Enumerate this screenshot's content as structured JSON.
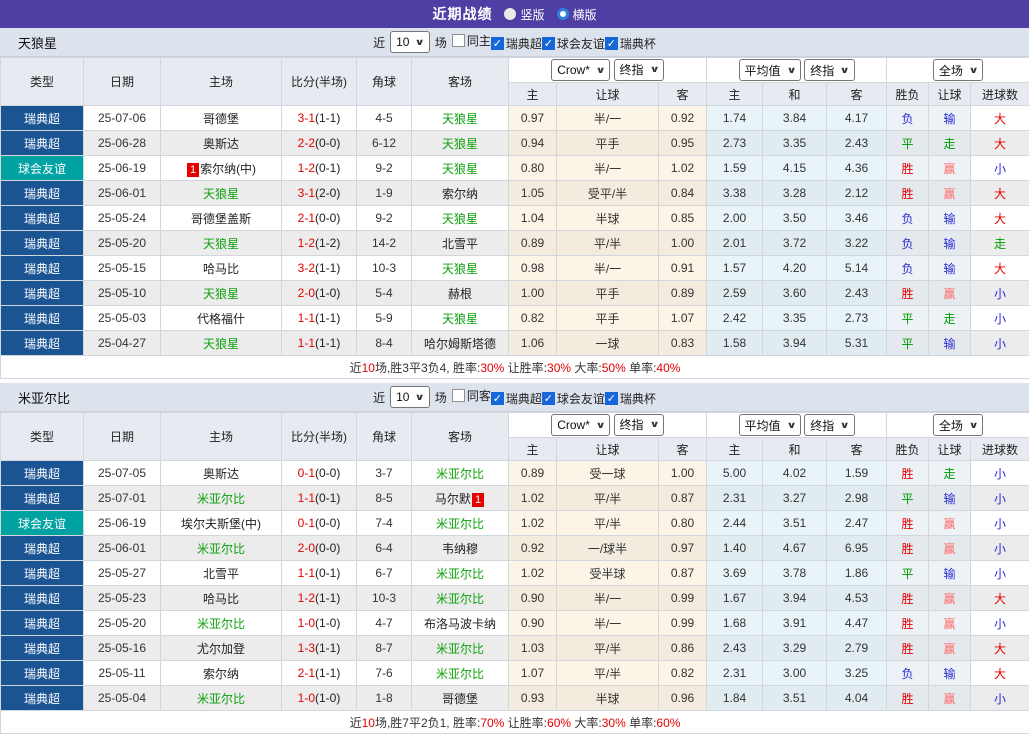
{
  "titlebar": {
    "title": "近期战绩",
    "vertical_label": "竖版",
    "horizontal_label": "横版",
    "bg_color": "#4D3FA3"
  },
  "filters": {
    "near_label": "近",
    "count": "10",
    "games_label": "场"
  },
  "table_header": {
    "type": "类型",
    "date": "日期",
    "home": "主场",
    "score": "比分(半场)",
    "corners": "角球",
    "away": "客场",
    "asia_selects": [
      "Crow*",
      "终指"
    ],
    "asia_cols": [
      "主",
      "让球",
      "客"
    ],
    "euro_selects": [
      "平均值",
      "终指"
    ],
    "euro_cols": [
      "主",
      "和",
      "客"
    ],
    "scope_select": "全场",
    "result_cols": [
      "胜负",
      "让球",
      "进球数"
    ]
  },
  "colors": {
    "type_map": {
      "瑞典超": "#1A5493",
      "球会友谊": "#00A2A2"
    },
    "focal_team": "#0DA10D",
    "normal_team": "#222222",
    "score_red": "#E60000",
    "result_map": {
      "胜": "#E60000",
      "负": "#2A2AD4",
      "平": "#009900",
      "赢": "#FF6A6A",
      "输": "#2A2AD4",
      "走": "#009900",
      "大": "#E60000",
      "小": "#2A2AD4"
    }
  },
  "sections": [
    {
      "team": "天狼星",
      "checkboxes": [
        {
          "label": "同主",
          "checked": false
        },
        {
          "label": "瑞典超",
          "checked": true
        },
        {
          "label": "球会友谊",
          "checked": true
        },
        {
          "label": "瑞典杯",
          "checked": true
        }
      ],
      "rows": [
        {
          "type": "瑞典超",
          "date": "25-07-06",
          "home": {
            "name": "哥德堡",
            "focal": false
          },
          "score": "3-1",
          "half": "(1-1)",
          "corners": "4-5",
          "away": {
            "name": "天狼星",
            "focal": true
          },
          "asia": [
            "0.97",
            "半/一",
            "0.92"
          ],
          "euro": [
            "1.74",
            "3.84",
            "4.17"
          ],
          "res": [
            "负",
            "输",
            "大"
          ]
        },
        {
          "type": "瑞典超",
          "date": "25-06-28",
          "home": {
            "name": "奥斯达",
            "focal": false
          },
          "score": "2-2",
          "half": "(0-0)",
          "corners": "6-12",
          "away": {
            "name": "天狼星",
            "focal": true
          },
          "asia": [
            "0.94",
            "平手",
            "0.95"
          ],
          "euro": [
            "2.73",
            "3.35",
            "2.43"
          ],
          "res": [
            "平",
            "走",
            "大"
          ]
        },
        {
          "type": "球会友谊",
          "date": "25-06-19",
          "home": {
            "name": "索尔纳(中)",
            "focal": false,
            "badge": "1",
            "badge_pos": "before"
          },
          "score": "1-2",
          "half": "(0-1)",
          "corners": "9-2",
          "away": {
            "name": "天狼星",
            "focal": true
          },
          "asia": [
            "0.80",
            "半/一",
            "1.02"
          ],
          "euro": [
            "1.59",
            "4.15",
            "4.36"
          ],
          "res": [
            "胜",
            "赢",
            "小"
          ]
        },
        {
          "type": "瑞典超",
          "date": "25-06-01",
          "home": {
            "name": "天狼星",
            "focal": true
          },
          "score": "3-1",
          "half": "(2-0)",
          "corners": "1-9",
          "away": {
            "name": "索尔纳",
            "focal": false
          },
          "asia": [
            "1.05",
            "受平/半",
            "0.84"
          ],
          "euro": [
            "3.38",
            "3.28",
            "2.12"
          ],
          "res": [
            "胜",
            "赢",
            "大"
          ]
        },
        {
          "type": "瑞典超",
          "date": "25-05-24",
          "home": {
            "name": "哥德堡盖斯",
            "focal": false
          },
          "score": "2-1",
          "half": "(0-0)",
          "corners": "9-2",
          "away": {
            "name": "天狼星",
            "focal": true
          },
          "asia": [
            "1.04",
            "半球",
            "0.85"
          ],
          "euro": [
            "2.00",
            "3.50",
            "3.46"
          ],
          "res": [
            "负",
            "输",
            "大"
          ]
        },
        {
          "type": "瑞典超",
          "date": "25-05-20",
          "home": {
            "name": "天狼星",
            "focal": true
          },
          "score": "1-2",
          "half": "(1-2)",
          "corners": "14-2",
          "away": {
            "name": "北雪平",
            "focal": false
          },
          "asia": [
            "0.89",
            "平/半",
            "1.00"
          ],
          "euro": [
            "2.01",
            "3.72",
            "3.22"
          ],
          "res": [
            "负",
            "输",
            "走"
          ]
        },
        {
          "type": "瑞典超",
          "date": "25-05-15",
          "home": {
            "name": "哈马比",
            "focal": false
          },
          "score": "3-2",
          "half": "(1-1)",
          "corners": "10-3",
          "away": {
            "name": "天狼星",
            "focal": true
          },
          "asia": [
            "0.98",
            "半/一",
            "0.91"
          ],
          "euro": [
            "1.57",
            "4.20",
            "5.14"
          ],
          "res": [
            "负",
            "输",
            "大"
          ]
        },
        {
          "type": "瑞典超",
          "date": "25-05-10",
          "home": {
            "name": "天狼星",
            "focal": true
          },
          "score": "2-0",
          "half": "(1-0)",
          "corners": "5-4",
          "away": {
            "name": "赫根",
            "focal": false
          },
          "asia": [
            "1.00",
            "平手",
            "0.89"
          ],
          "euro": [
            "2.59",
            "3.60",
            "2.43"
          ],
          "res": [
            "胜",
            "赢",
            "小"
          ]
        },
        {
          "type": "瑞典超",
          "date": "25-05-03",
          "home": {
            "name": "代格福什",
            "focal": false
          },
          "score": "1-1",
          "half": "(1-1)",
          "corners": "5-9",
          "away": {
            "name": "天狼星",
            "focal": true
          },
          "asia": [
            "0.82",
            "平手",
            "1.07"
          ],
          "euro": [
            "2.42",
            "3.35",
            "2.73"
          ],
          "res": [
            "平",
            "走",
            "小"
          ]
        },
        {
          "type": "瑞典超",
          "date": "25-04-27",
          "home": {
            "name": "天狼星",
            "focal": true
          },
          "score": "1-1",
          "half": "(1-1)",
          "corners": "8-4",
          "away": {
            "name": "哈尔姆斯塔德",
            "focal": false
          },
          "asia": [
            "1.06",
            "一球",
            "0.83"
          ],
          "euro": [
            "1.58",
            "3.94",
            "5.31"
          ],
          "res": [
            "平",
            "输",
            "小"
          ]
        }
      ],
      "summary_parts": [
        {
          "t": "近",
          "c": "k"
        },
        {
          "t": "10",
          "c": "r"
        },
        {
          "t": "场,胜3平3负4, 胜率:",
          "c": "k"
        },
        {
          "t": "30%",
          "c": "r"
        },
        {
          "t": " 让胜率:",
          "c": "k"
        },
        {
          "t": "30%",
          "c": "r"
        },
        {
          "t": " 大率:",
          "c": "k"
        },
        {
          "t": "50%",
          "c": "r"
        },
        {
          "t": " 单率:",
          "c": "k"
        },
        {
          "t": "40%",
          "c": "r"
        }
      ]
    },
    {
      "team": "米亚尔比",
      "checkboxes": [
        {
          "label": "同客",
          "checked": false
        },
        {
          "label": "瑞典超",
          "checked": true
        },
        {
          "label": "球会友谊",
          "checked": true
        },
        {
          "label": "瑞典杯",
          "checked": true
        }
      ],
      "rows": [
        {
          "type": "瑞典超",
          "date": "25-07-05",
          "home": {
            "name": "奥斯达",
            "focal": false
          },
          "score": "0-1",
          "half": "(0-0)",
          "corners": "3-7",
          "away": {
            "name": "米亚尔比",
            "focal": true
          },
          "asia": [
            "0.89",
            "受一球",
            "1.00"
          ],
          "euro": [
            "5.00",
            "4.02",
            "1.59"
          ],
          "res": [
            "胜",
            "走",
            "小"
          ]
        },
        {
          "type": "瑞典超",
          "date": "25-07-01",
          "home": {
            "name": "米亚尔比",
            "focal": true
          },
          "score": "1-1",
          "half": "(0-1)",
          "corners": "8-5",
          "away": {
            "name": "马尔默",
            "focal": false,
            "badge": "1",
            "badge_pos": "after"
          },
          "asia": [
            "1.02",
            "平/半",
            "0.87"
          ],
          "euro": [
            "2.31",
            "3.27",
            "2.98"
          ],
          "res": [
            "平",
            "输",
            "小"
          ]
        },
        {
          "type": "球会友谊",
          "date": "25-06-19",
          "home": {
            "name": "埃尔夫斯堡(中)",
            "focal": false
          },
          "score": "0-1",
          "half": "(0-0)",
          "corners": "7-4",
          "away": {
            "name": "米亚尔比",
            "focal": true
          },
          "asia": [
            "1.02",
            "平/半",
            "0.80"
          ],
          "euro": [
            "2.44",
            "3.51",
            "2.47"
          ],
          "res": [
            "胜",
            "赢",
            "小"
          ]
        },
        {
          "type": "瑞典超",
          "date": "25-06-01",
          "home": {
            "name": "米亚尔比",
            "focal": true
          },
          "score": "2-0",
          "half": "(0-0)",
          "corners": "6-4",
          "away": {
            "name": "韦纳穆",
            "focal": false
          },
          "asia": [
            "0.92",
            "一/球半",
            "0.97"
          ],
          "euro": [
            "1.40",
            "4.67",
            "6.95"
          ],
          "res": [
            "胜",
            "赢",
            "小"
          ]
        },
        {
          "type": "瑞典超",
          "date": "25-05-27",
          "home": {
            "name": "北雪平",
            "focal": false
          },
          "score": "1-1",
          "half": "(0-1)",
          "corners": "6-7",
          "away": {
            "name": "米亚尔比",
            "focal": true
          },
          "asia": [
            "1.02",
            "受半球",
            "0.87"
          ],
          "euro": [
            "3.69",
            "3.78",
            "1.86"
          ],
          "res": [
            "平",
            "输",
            "小"
          ]
        },
        {
          "type": "瑞典超",
          "date": "25-05-23",
          "home": {
            "name": "哈马比",
            "focal": false
          },
          "score": "1-2",
          "half": "(1-1)",
          "corners": "10-3",
          "away": {
            "name": "米亚尔比",
            "focal": true
          },
          "asia": [
            "0.90",
            "半/一",
            "0.99"
          ],
          "euro": [
            "1.67",
            "3.94",
            "4.53"
          ],
          "res": [
            "胜",
            "赢",
            "大"
          ]
        },
        {
          "type": "瑞典超",
          "date": "25-05-20",
          "home": {
            "name": "米亚尔比",
            "focal": true
          },
          "score": "1-0",
          "half": "(1-0)",
          "corners": "4-7",
          "away": {
            "name": "布洛马波卡纳",
            "focal": false
          },
          "asia": [
            "0.90",
            "半/一",
            "0.99"
          ],
          "euro": [
            "1.68",
            "3.91",
            "4.47"
          ],
          "res": [
            "胜",
            "赢",
            "小"
          ]
        },
        {
          "type": "瑞典超",
          "date": "25-05-16",
          "home": {
            "name": "尤尔加登",
            "focal": false
          },
          "score": "1-3",
          "half": "(1-1)",
          "corners": "8-7",
          "away": {
            "name": "米亚尔比",
            "focal": true
          },
          "asia": [
            "1.03",
            "平/半",
            "0.86"
          ],
          "euro": [
            "2.43",
            "3.29",
            "2.79"
          ],
          "res": [
            "胜",
            "赢",
            "大"
          ]
        },
        {
          "type": "瑞典超",
          "date": "25-05-11",
          "home": {
            "name": "索尔纳",
            "focal": false
          },
          "score": "2-1",
          "half": "(1-1)",
          "corners": "7-6",
          "away": {
            "name": "米亚尔比",
            "focal": true
          },
          "asia": [
            "1.07",
            "平/半",
            "0.82"
          ],
          "euro": [
            "2.31",
            "3.00",
            "3.25"
          ],
          "res": [
            "负",
            "输",
            "大"
          ]
        },
        {
          "type": "瑞典超",
          "date": "25-05-04",
          "home": {
            "name": "米亚尔比",
            "focal": true
          },
          "score": "1-0",
          "half": "(1-0)",
          "corners": "1-8",
          "away": {
            "name": "哥德堡",
            "focal": false
          },
          "asia": [
            "0.93",
            "半球",
            "0.96"
          ],
          "euro": [
            "1.84",
            "3.51",
            "4.04"
          ],
          "res": [
            "胜",
            "赢",
            "小"
          ]
        }
      ],
      "summary_parts": [
        {
          "t": "近",
          "c": "k"
        },
        {
          "t": "10",
          "c": "r"
        },
        {
          "t": "场,胜7平2负1, 胜率:",
          "c": "k"
        },
        {
          "t": "70%",
          "c": "r"
        },
        {
          "t": " 让胜率:",
          "c": "k"
        },
        {
          "t": "60%",
          "c": "r"
        },
        {
          "t": " 大率:",
          "c": "k"
        },
        {
          "t": "30%",
          "c": "r"
        },
        {
          "t": " 单率:",
          "c": "k"
        },
        {
          "t": "60%",
          "c": "r"
        }
      ]
    }
  ]
}
